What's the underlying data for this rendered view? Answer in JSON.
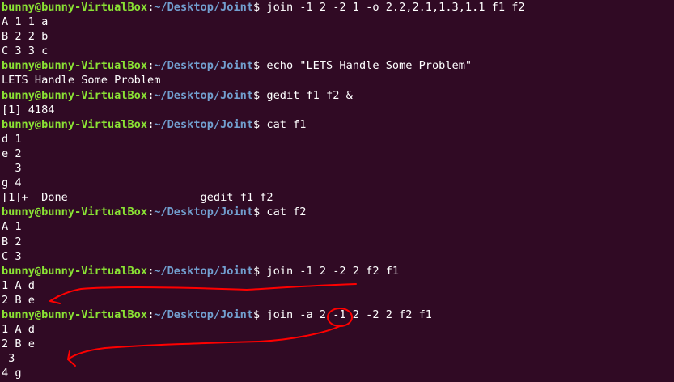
{
  "prompt": {
    "user_host": "bunny@bunny-VirtualBox",
    "colon": ":",
    "path": "~/Desktop/Joint",
    "symbol": "$"
  },
  "lines": [
    {
      "type": "prompt",
      "command": " join -1 2 -2 1 -o 2.2,2.1,1.3,1.1 f1 f2"
    },
    {
      "type": "output",
      "text": "A 1 1 a"
    },
    {
      "type": "output",
      "text": "B 2 2 b"
    },
    {
      "type": "output",
      "text": "C 3 3 c"
    },
    {
      "type": "prompt",
      "command": " echo \"LETS Handle Some Problem\""
    },
    {
      "type": "output",
      "text": "LETS Handle Some Problem"
    },
    {
      "type": "prompt",
      "command": " gedit f1 f2 &"
    },
    {
      "type": "output",
      "text": "[1] 4184"
    },
    {
      "type": "prompt",
      "command": " cat f1"
    },
    {
      "type": "output",
      "text": "d 1"
    },
    {
      "type": "output",
      "text": "e 2"
    },
    {
      "type": "output",
      "text": "  3"
    },
    {
      "type": "output",
      "text": "g 4"
    },
    {
      "type": "output",
      "text": "[1]+  Done                    gedit f1 f2"
    },
    {
      "type": "prompt",
      "command": " cat f2"
    },
    {
      "type": "output",
      "text": "A 1"
    },
    {
      "type": "output",
      "text": "B 2"
    },
    {
      "type": "output",
      "text": "C 3"
    },
    {
      "type": "prompt",
      "command": " join -1 2 -2 2 f2 f1"
    },
    {
      "type": "output",
      "text": "1 A d"
    },
    {
      "type": "output",
      "text": "2 B e"
    },
    {
      "type": "prompt",
      "command": " join -a 2 -1 2 -2 2 f2 f1"
    },
    {
      "type": "output",
      "text": "1 A d"
    },
    {
      "type": "output",
      "text": "2 B e"
    },
    {
      "type": "output",
      "text": " 3"
    },
    {
      "type": "output",
      "text": "4 g"
    }
  ],
  "colors": {
    "background": "#300a24",
    "user_host": "#8ae234",
    "path": "#729fcf",
    "text": "#ffffff",
    "annotation": "#ff0000"
  }
}
